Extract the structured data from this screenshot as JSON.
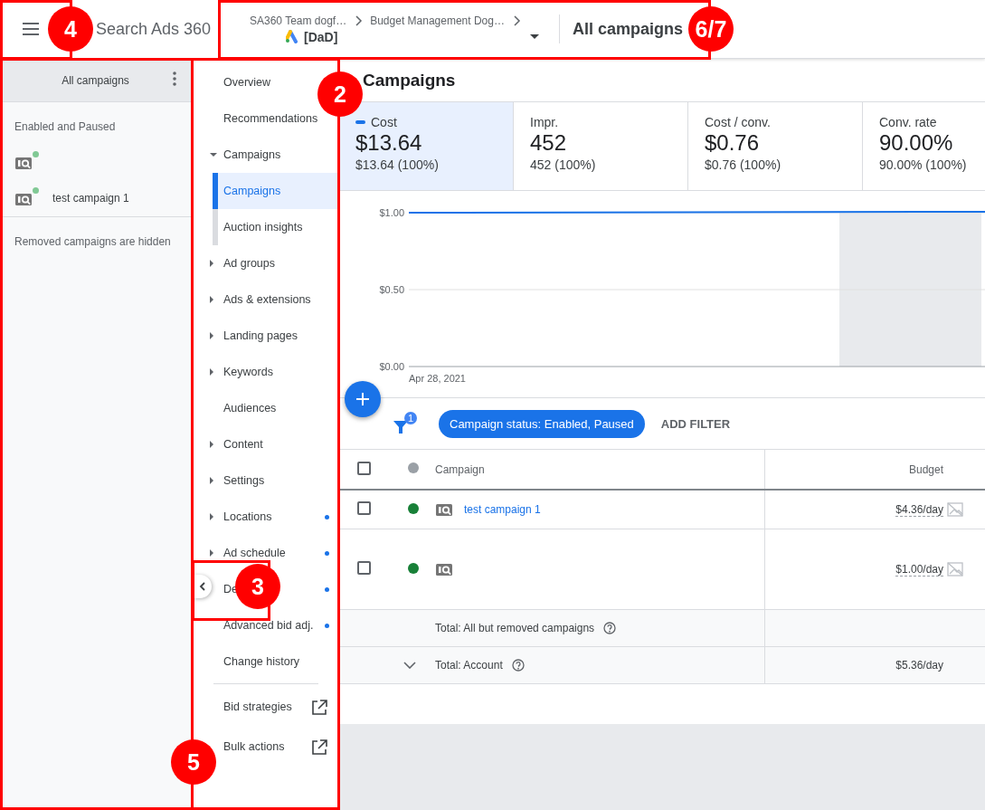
{
  "top_bar": {
    "product": "Search Ads 360",
    "breadcrumb": [
      "SA360 Team dogf…",
      "Budget Management Dog…"
    ],
    "account": "[DaD]",
    "title": "All campaigns"
  },
  "campaign_panel": {
    "title": "All campaigns",
    "group_label": "Enabled and Paused",
    "items": [
      {
        "color": "#81c995"
      },
      {
        "name": "test campaign 1",
        "color": "#81c995"
      }
    ],
    "note": "Removed campaigns are hidden"
  },
  "nav": {
    "items": [
      {
        "kind": "page",
        "label": "Overview"
      },
      {
        "kind": "page",
        "label": "Recommendations"
      },
      {
        "kind": "group",
        "label": "Campaigns",
        "expanded": true
      },
      {
        "kind": "subpage",
        "label": "Campaigns",
        "selected": true
      },
      {
        "kind": "subpage",
        "label": "Auction insights",
        "selected": false
      },
      {
        "kind": "group",
        "label": "Ad groups",
        "expanded": false
      },
      {
        "kind": "group",
        "label": "Ads & extensions",
        "expanded": false
      },
      {
        "kind": "group",
        "label": "Landing pages",
        "expanded": false
      },
      {
        "kind": "group",
        "label": "Keywords",
        "expanded": false
      },
      {
        "kind": "page",
        "label": "Audiences"
      },
      {
        "kind": "group",
        "label": "Content",
        "expanded": false
      },
      {
        "kind": "group",
        "label": "Settings",
        "expanded": false
      },
      {
        "kind": "group",
        "label": "Locations",
        "expanded": false,
        "dot": true
      },
      {
        "kind": "group",
        "label": "Ad schedule",
        "expanded": false,
        "dot": true
      },
      {
        "kind": "page",
        "label": "De",
        "dot": true
      },
      {
        "kind": "page",
        "label": "Advanced bid adj.",
        "dot": true
      },
      {
        "kind": "page",
        "label": "Change history"
      },
      {
        "kind": "divider"
      },
      {
        "kind": "external",
        "label": "Bid strategies"
      },
      {
        "kind": "external",
        "label": "Bulk actions"
      }
    ]
  },
  "main": {
    "title": "Campaigns",
    "metrics": [
      {
        "label": "Cost",
        "value": "$13.64",
        "share": "$13.64 (100%)",
        "selected": true
      },
      {
        "label": "Impr.",
        "value": "452",
        "share": "452 (100%)",
        "selected": false
      },
      {
        "label": "Cost / conv.",
        "value": "$0.76",
        "share": "$0.76 (100%)",
        "selected": false
      },
      {
        "label": "Conv. rate",
        "value": "90.00%",
        "share": "90.00% (100%)",
        "selected": false
      }
    ],
    "chart": {
      "y_labels": [
        "$1.00",
        "$0.50",
        "$0.00"
      ],
      "date_label": "Apr 28, 2021"
    },
    "filter": {
      "count": "1",
      "chip": "Campaign status: Enabled, Paused",
      "add": "ADD FILTER"
    },
    "table": {
      "select_all": {
        "checked": false
      },
      "columns": [
        "Campaign",
        "Budget"
      ],
      "rows": [
        {
          "checked": false,
          "color": "#188038",
          "name": "test campaign 1",
          "budget": "$4.36/day"
        },
        {
          "checked": false,
          "color": "#188038",
          "budget": "$1.00/day"
        }
      ],
      "totals": [
        {
          "label": "Total: All but removed campaigns",
          "expandable": false
        },
        {
          "label": "Total: Account",
          "budget": "$5.36/day",
          "expandable": true
        }
      ]
    }
  },
  "annotations": [
    {
      "label": "4"
    },
    {
      "label": "6/7"
    },
    {
      "label": "2"
    },
    {
      "label": "3"
    },
    {
      "label": "5"
    }
  ]
}
